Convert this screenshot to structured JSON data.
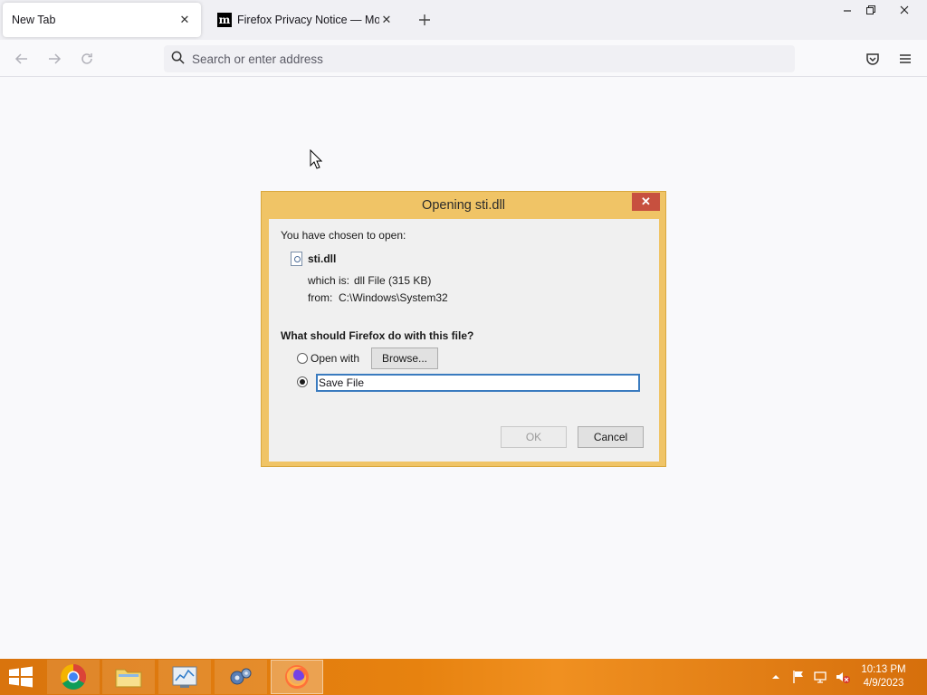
{
  "browser": {
    "tabs": [
      {
        "label": "New Tab",
        "active": true
      },
      {
        "label": "Firefox Privacy Notice — Mozilla",
        "active": false
      }
    ],
    "address_placeholder": "Search or enter address"
  },
  "dialog": {
    "title": "Opening sti.dll",
    "intro": "You have chosen to open:",
    "file_name": "sti.dll",
    "which_is_label": "which is:",
    "which_is_value": "dll File (315 KB)",
    "from_label": "from:",
    "from_value": "C:\\Windows\\System32",
    "question": "What should Firefox do with this file?",
    "open_with_label": "Open with",
    "browse_label": "Browse...",
    "save_file_label": "Save File",
    "selected_option": "save_file",
    "ok_label": "OK",
    "cancel_label": "Cancel"
  },
  "taskbar": {
    "apps": [
      "chrome",
      "file-explorer",
      "task-manager",
      "settings",
      "firefox"
    ],
    "active_app": "firefox",
    "time": "10:13 PM",
    "date": "4/9/2023"
  },
  "colors": {
    "dialog_frame": "#f0c466",
    "taskbar": "#e07b0e",
    "close_button": "#c7503f",
    "focus_outline": "#3a7bbf"
  }
}
